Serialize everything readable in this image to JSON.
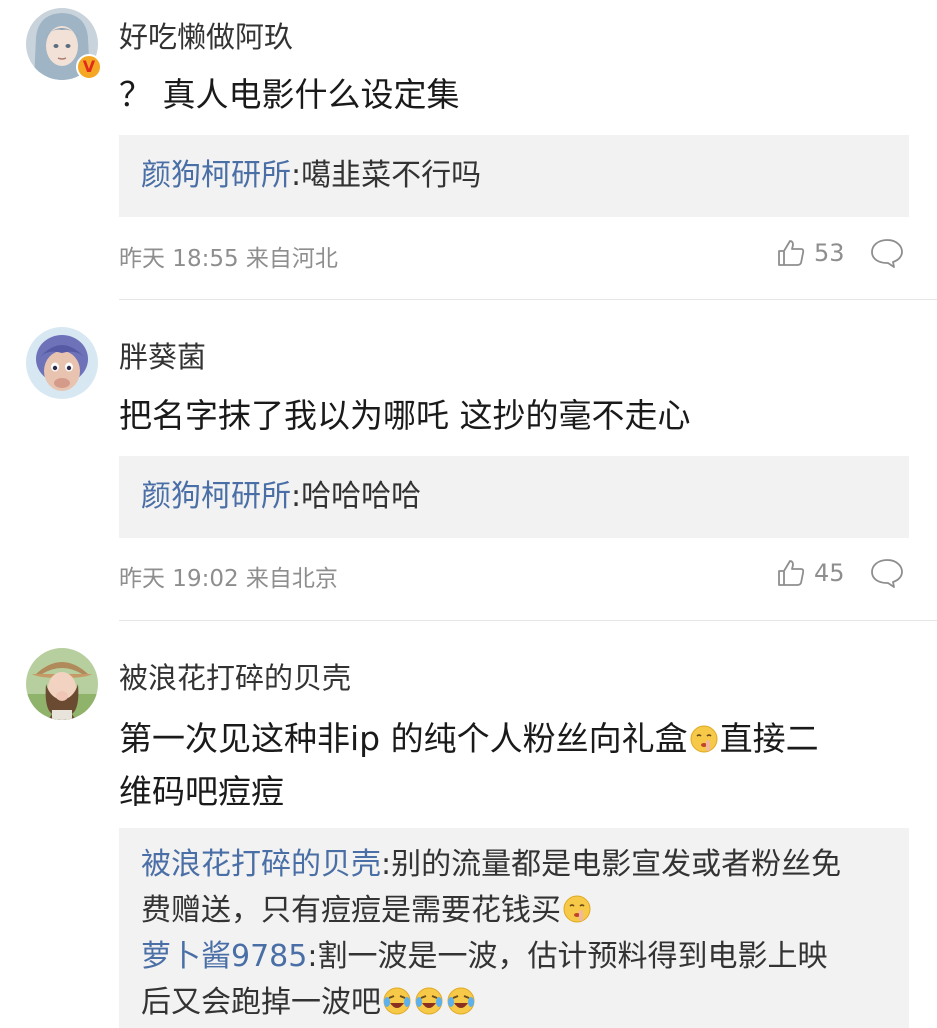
{
  "comments": [
    {
      "username": "好吃懒做阿玖",
      "text": "？ 真人电影什么设定集",
      "reply": {
        "author": "颜狗柯研所",
        "separator": ":",
        "text": "噶韭菜不行吗"
      },
      "meta": "昨天 18:55 来自河北",
      "likes": "53",
      "avatar_icon": "anime-avatar-icon",
      "verified": true
    },
    {
      "username": "胖葵菌",
      "text": "把名字抹了我以为哪吒 这抄的毫不走心",
      "reply": {
        "author": "颜狗柯研所",
        "separator": ":",
        "text": "哈哈哈哈"
      },
      "meta": "昨天 19:02 来自北京",
      "likes": "45",
      "avatar_icon": "cartoon-avatar-icon"
    },
    {
      "username": "被浪花打碎的贝壳",
      "text_line1": "第一次见这种非ip 的纯个人粉丝向礼盒",
      "text_line1_after": "直接二",
      "text_line2": "维码吧痘痘",
      "replies": [
        {
          "author": "被浪花打碎的贝壳",
          "separator": ":",
          "line1": "别的流量都是电影宣发或者粉丝免",
          "line2": "费赠送，只有痘痘是需要花钱买"
        },
        {
          "author": "萝卜酱9785",
          "separator": ":",
          "line1": "割一波是一波，估计预料得到电影上映",
          "line2": "后又会跑掉一波吧"
        }
      ],
      "avatar_icon": "photo-avatar-icon"
    }
  ],
  "colors": {
    "reply_author": "#4a6fa6",
    "reply_bg": "#f2f2f2",
    "meta": "#8e8e8e"
  }
}
